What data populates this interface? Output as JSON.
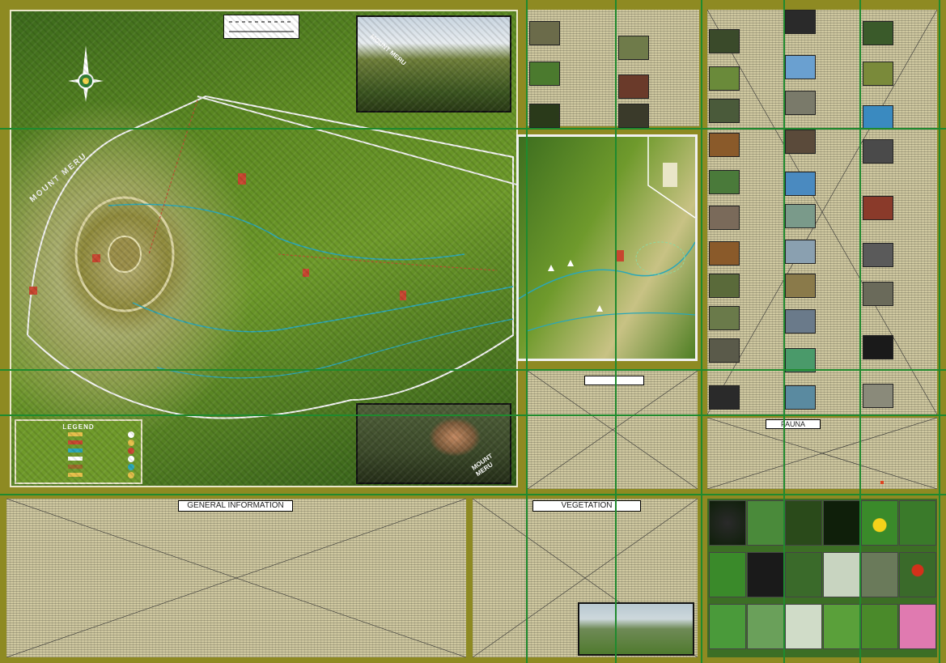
{
  "map": {
    "mountain_label": "MOUNT MERU",
    "inset_label": "MOUNT MERU",
    "crater_label": "MOUNT MERU",
    "legend_title": "LEGEND",
    "legend_items": [
      "",
      "",
      "",
      "",
      "",
      "",
      "",
      "",
      "",
      "",
      "",
      "",
      "",
      ""
    ]
  },
  "sections": {
    "general_info_title": "GENERAL INFORMATION",
    "vegetation_title": "VEGETATION",
    "fauna_title": "FAUNA"
  },
  "colors": {
    "frame": "#8e8a22",
    "grid": "#1f8a2e",
    "panel": "#cfc8a0"
  },
  "icons": {
    "compass": "compass-rose-icon"
  }
}
